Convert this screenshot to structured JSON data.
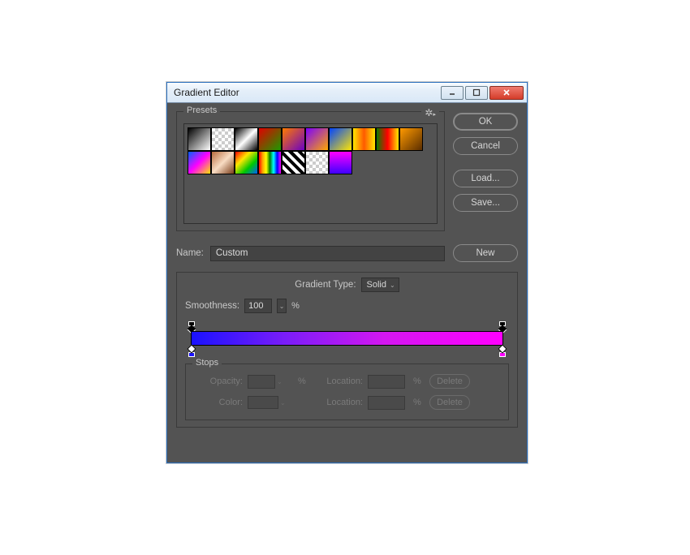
{
  "window": {
    "title": "Gradient Editor"
  },
  "presets": {
    "legend": "Presets",
    "gear_icon": "gear-icon"
  },
  "buttons": {
    "ok": "OK",
    "cancel": "Cancel",
    "load": "Load...",
    "save": "Save...",
    "new": "New",
    "delete": "Delete"
  },
  "name": {
    "label": "Name:",
    "value": "Custom"
  },
  "gradient": {
    "type_label": "Gradient Type:",
    "type_value": "Solid",
    "smooth_label": "Smoothness:",
    "smooth_value": "100",
    "pct": "%",
    "colors": {
      "start": "#1a12ff",
      "end": "#ff00ff"
    }
  },
  "stops": {
    "legend": "Stops",
    "opacity_label": "Opacity:",
    "location_label": "Location:",
    "color_label": "Color:",
    "pct": "%"
  }
}
